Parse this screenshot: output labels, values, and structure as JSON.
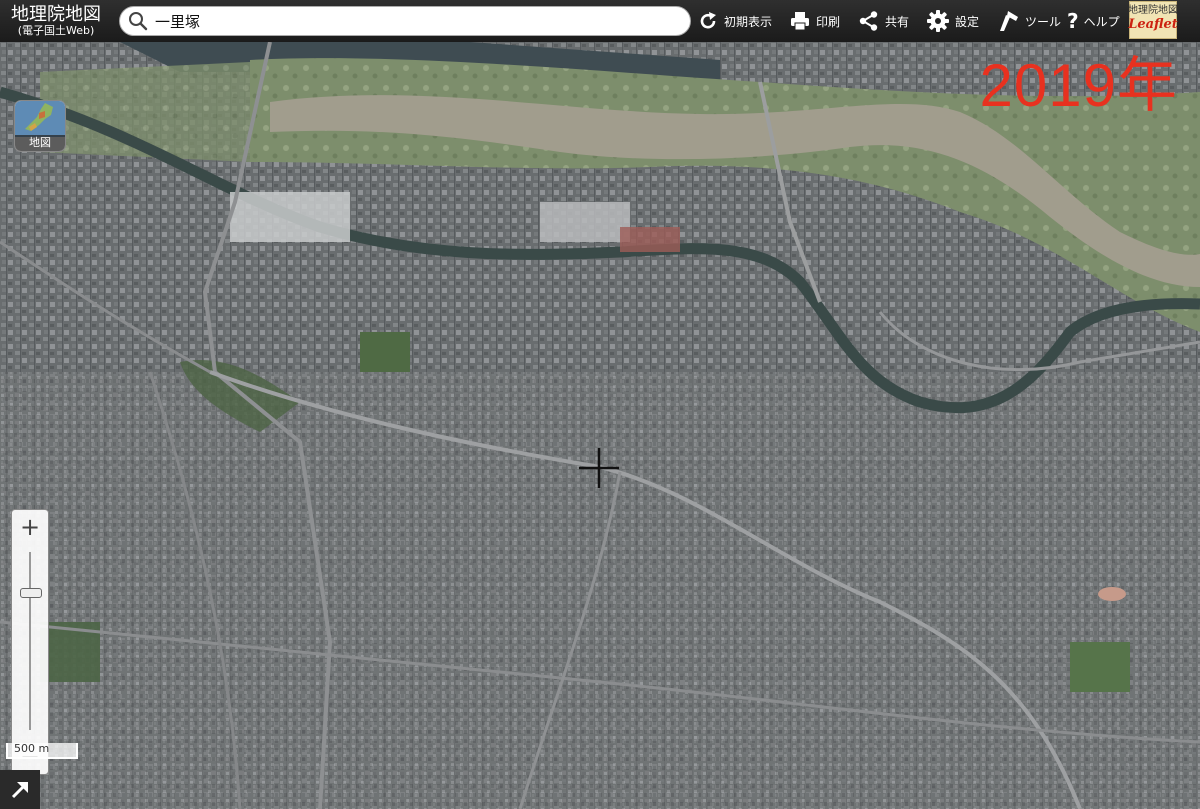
{
  "header": {
    "logo_title": "地理院地図",
    "logo_subtitle": "(電子国土Web)",
    "search_value": "一里塚",
    "menu": [
      {
        "label": "初期表示",
        "icon": "reset-icon"
      },
      {
        "label": "印刷",
        "icon": "print-icon"
      },
      {
        "label": "共有",
        "icon": "share-icon"
      },
      {
        "label": "設定",
        "icon": "gear-icon"
      },
      {
        "label": "ツール",
        "icon": "tool-icon"
      },
      {
        "label": "ヘルプ",
        "icon": "help-icon"
      }
    ],
    "badge_title": "地理院地図",
    "badge_brand": "Leaflet"
  },
  "map": {
    "year_label": "2019年",
    "layer_button_label": "地図",
    "zoom_in_symbol": "+",
    "zoom_out_symbol": "−",
    "scale_label": "500 m",
    "colors": {
      "river": "#a19d8d",
      "riverbank": "#7f8f6e",
      "canal": "#4b5a55",
      "urban": "#6a6d70",
      "year_text": "#e8311f"
    }
  }
}
